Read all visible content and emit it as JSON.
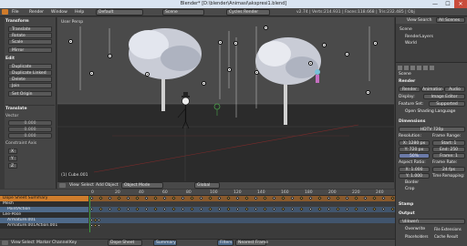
{
  "window": {
    "title": "Blender* [D:\\blender\\Animasi\\akspresi1.blend]",
    "min": "—",
    "max": "☐",
    "close": "✕"
  },
  "info": {
    "menus": [
      "File",
      "Render",
      "Window",
      "Help"
    ],
    "layout": "Default",
    "scene": "Scene",
    "engine": "Cycles Render",
    "stats": "v2.74 | Verts:214.931 | Faces:118.668 | Tris:232.485 | Obj"
  },
  "shelf": {
    "transform_header": "Transform",
    "transform_buttons": [
      "Translate",
      "Rotate",
      "Scale",
      "Mirror"
    ],
    "edit_header": "Edit",
    "edit_buttons": [
      "Duplicate",
      "Duplicate Linked",
      "Delete",
      "Join"
    ],
    "set_origin": "Set Origin",
    "translate_header": "Translate",
    "vector_label": "Vector",
    "vector_values": [
      "0.000",
      "0.000",
      "0.000"
    ],
    "constraint_label": "Constraint Axis",
    "constraint_values": [
      "X",
      "Y",
      "Z"
    ]
  },
  "viewport": {
    "view_label": "User Persp",
    "object_label": "(1) Cube.001",
    "header": {
      "view": "View",
      "select": "Select",
      "add": "Add",
      "object": "Object",
      "mode": "Object Mode",
      "pivot": "Global"
    }
  },
  "props": {
    "outliner": {
      "view": "View",
      "search": "Search",
      "scene": "All Scenes",
      "items": [
        "Scene",
        "RenderLayers",
        "World"
      ]
    },
    "scene_label": "Scene",
    "render_header": "Render",
    "render_buttons": [
      "Render",
      "Animation",
      "Audio"
    ],
    "display_label": "Display:",
    "display_value": "Image Editor",
    "feature_label": "Feature Set:",
    "feature_value": "Supported",
    "osl_label": "Open Shading Language",
    "dimensions_header": "Dimensions",
    "preset": "HDTV 720p",
    "resolution_label": "Resolution:",
    "res_x": "X: 1280 px",
    "res_y": "Y: 720 px",
    "res_pct": "50%",
    "frame_range_label": "Frame Range:",
    "frame_start": "Start: 1",
    "frame_end": "End: 250",
    "frame_step": "Frame: 1",
    "aspect_label": "Aspect Ratio:",
    "aspect_x": "X: 1.000",
    "aspect_y": "Y: 1.000",
    "fps_label": "Frame Rate:",
    "fps_value": "24 fps",
    "time_remap": "Time Remapping:",
    "border": "Border",
    "crop": "Crop",
    "stamp_header": "Stamp",
    "output_header": "Output",
    "output_path": "\\dikwer\\",
    "overwrite": "Overwrite",
    "file_ext": "File Extensions",
    "placeholders": "Placeholders",
    "cache_result": "Cache Result"
  },
  "dopesheet": {
    "header": {
      "view": "View",
      "select": "Select",
      "marker": "Marker",
      "channel": "Channel",
      "key": "Key",
      "mode": "Dope Sheet",
      "summary": "Summary",
      "filters": "Filters",
      "nearest": "Nearest Frame"
    },
    "channels": [
      "Dope Sheet Summary",
      "Mesh",
      "PointAction",
      "Lee-Pose",
      "Armature.001",
      "Armature.001Action.001"
    ],
    "ticks": [
      "0",
      "10",
      "20",
      "30",
      "40",
      "50",
      "60",
      "70",
      "80",
      "90",
      "100",
      "110",
      "120",
      "130",
      "140",
      "150",
      "160",
      "170",
      "180",
      "190",
      "200",
      "210",
      "220",
      "230",
      "240",
      "250"
    ]
  },
  "colors": {
    "accent_orange": "#d0802a",
    "selected_blue": "#5680c2",
    "playhead_green": "#3c9c3c"
  }
}
